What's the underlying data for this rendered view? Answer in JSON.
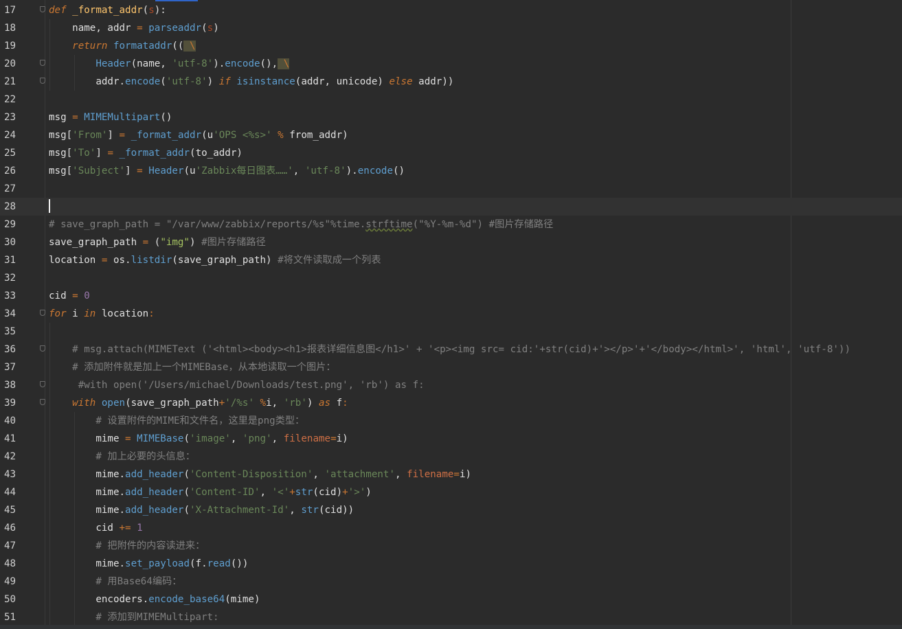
{
  "editor": {
    "language": "python",
    "current_line": 28,
    "colors": {
      "background": "#2b2b2b",
      "current_line": "#323232",
      "keyword": "#cc7832",
      "function": "#ffc66d",
      "string": "#6a8759",
      "number": "#9876aa",
      "comment": "#808080",
      "call": "#5f9fd0"
    },
    "lines": [
      {
        "n": "17",
        "tokens": [
          [
            "kw",
            "def"
          ],
          [
            "plain",
            " "
          ],
          [
            "fn",
            "_format_addr"
          ],
          [
            "plain",
            "("
          ],
          [
            "self",
            "s"
          ],
          [
            "plain",
            "):"
          ]
        ]
      },
      {
        "n": "18",
        "tokens": [
          [
            "plain",
            "    name, addr "
          ],
          [
            "op",
            "="
          ],
          [
            "plain",
            " "
          ],
          [
            "call",
            "parseaddr"
          ],
          [
            "plain",
            "("
          ],
          [
            "self",
            "s"
          ],
          [
            "plain",
            ")"
          ]
        ]
      },
      {
        "n": "19",
        "tokens": [
          [
            "plain",
            "    "
          ],
          [
            "kw",
            "return"
          ],
          [
            "plain",
            " "
          ],
          [
            "call",
            "formataddr"
          ],
          [
            "plain",
            "(("
          ],
          [
            "esc",
            " \\"
          ]
        ]
      },
      {
        "n": "20",
        "tokens": [
          [
            "plain",
            "        "
          ],
          [
            "call",
            "Header"
          ],
          [
            "plain",
            "(name, "
          ],
          [
            "str",
            "'utf-8'"
          ],
          [
            "plain",
            ")."
          ],
          [
            "call",
            "encode"
          ],
          [
            "plain",
            "(),"
          ],
          [
            "esc",
            " \\"
          ]
        ]
      },
      {
        "n": "21",
        "tokens": [
          [
            "plain",
            "        addr."
          ],
          [
            "call",
            "encode"
          ],
          [
            "plain",
            "("
          ],
          [
            "str",
            "'utf-8'"
          ],
          [
            "plain",
            ") "
          ],
          [
            "kw",
            "if"
          ],
          [
            "plain",
            " "
          ],
          [
            "call",
            "isinstance"
          ],
          [
            "plain",
            "(addr, unicode) "
          ],
          [
            "kw",
            "else"
          ],
          [
            "plain",
            " addr))"
          ]
        ]
      },
      {
        "n": "22",
        "tokens": []
      },
      {
        "n": "23",
        "tokens": [
          [
            "plain",
            "msg "
          ],
          [
            "op",
            "="
          ],
          [
            "plain",
            " "
          ],
          [
            "call",
            "MIMEMultipart"
          ],
          [
            "plain",
            "()"
          ]
        ]
      },
      {
        "n": "24",
        "tokens": [
          [
            "plain",
            "msg["
          ],
          [
            "str",
            "'From'"
          ],
          [
            "plain",
            "] "
          ],
          [
            "op",
            "="
          ],
          [
            "plain",
            " "
          ],
          [
            "call",
            "_format_addr"
          ],
          [
            "plain",
            "(u"
          ],
          [
            "str",
            "'OPS <%s>'"
          ],
          [
            "plain",
            " "
          ],
          [
            "op",
            "%"
          ],
          [
            "plain",
            " from_addr)"
          ]
        ]
      },
      {
        "n": "25",
        "tokens": [
          [
            "plain",
            "msg["
          ],
          [
            "str",
            "'To'"
          ],
          [
            "plain",
            "] "
          ],
          [
            "op",
            "="
          ],
          [
            "plain",
            " "
          ],
          [
            "call",
            "_format_addr"
          ],
          [
            "plain",
            "(to_addr)"
          ]
        ]
      },
      {
        "n": "26",
        "tokens": [
          [
            "plain",
            "msg["
          ],
          [
            "str",
            "'Subject'"
          ],
          [
            "plain",
            "] "
          ],
          [
            "op",
            "="
          ],
          [
            "plain",
            " "
          ],
          [
            "call",
            "Header"
          ],
          [
            "plain",
            "(u"
          ],
          [
            "str",
            "'Zabbix每日图表……'"
          ],
          [
            "plain",
            ", "
          ],
          [
            "str",
            "'utf-8'"
          ],
          [
            "plain",
            ")."
          ],
          [
            "call",
            "encode"
          ],
          [
            "plain",
            "()"
          ]
        ]
      },
      {
        "n": "27",
        "tokens": []
      },
      {
        "n": "28",
        "tokens": [
          [
            "caret",
            ""
          ]
        ]
      },
      {
        "n": "29",
        "tokens": [
          [
            "cm",
            "# save_graph_path = \"/var/www/zabbix/reports/%s\"%time."
          ],
          [
            "cmw",
            "strftime"
          ],
          [
            "cm",
            "(\"%Y-%m-%d\") #图片存储路径"
          ]
        ]
      },
      {
        "n": "30",
        "tokens": [
          [
            "plain",
            "save_graph_path "
          ],
          [
            "op",
            "="
          ],
          [
            "plain",
            " ("
          ],
          [
            "str2",
            "\"img\""
          ],
          [
            "plain",
            ") "
          ],
          [
            "cm",
            "#图片存储路径"
          ]
        ]
      },
      {
        "n": "31",
        "tokens": [
          [
            "plain",
            "location "
          ],
          [
            "op",
            "="
          ],
          [
            "plain",
            " os."
          ],
          [
            "call",
            "listdir"
          ],
          [
            "plain",
            "(save_graph_path) "
          ],
          [
            "cm",
            "#将文件读取成一个列表"
          ]
        ]
      },
      {
        "n": "32",
        "tokens": []
      },
      {
        "n": "33",
        "tokens": [
          [
            "plain",
            "cid "
          ],
          [
            "op",
            "="
          ],
          [
            "plain",
            " "
          ],
          [
            "num",
            "0"
          ]
        ]
      },
      {
        "n": "34",
        "tokens": [
          [
            "kw",
            "for"
          ],
          [
            "plain",
            " i "
          ],
          [
            "kw",
            "in"
          ],
          [
            "plain",
            " location"
          ],
          [
            "op",
            ":"
          ]
        ]
      },
      {
        "n": "35",
        "tokens": []
      },
      {
        "n": "36",
        "tokens": [
          [
            "plain",
            "    "
          ],
          [
            "cm",
            "# msg.attach(MIMEText ('<html><body><h1>报表详细信息图</h1>' + '<p><img src= cid:'+str(cid)+'></p>'+'</body></html>', 'html', 'utf-8'))"
          ]
        ]
      },
      {
        "n": "37",
        "tokens": [
          [
            "plain",
            "    "
          ],
          [
            "cm",
            "# 添加附件就是加上一个MIMEBase，从本地读取一个图片："
          ]
        ]
      },
      {
        "n": "38",
        "tokens": [
          [
            "plain",
            "     "
          ],
          [
            "cm",
            "#with open('/Users/michael/Downloads/test.png', 'rb') as f:"
          ]
        ]
      },
      {
        "n": "39",
        "tokens": [
          [
            "plain",
            "    "
          ],
          [
            "kw",
            "with"
          ],
          [
            "plain",
            " "
          ],
          [
            "call",
            "open"
          ],
          [
            "plain",
            "(save_graph_path"
          ],
          [
            "op",
            "+"
          ],
          [
            "str",
            "'/%s'"
          ],
          [
            "plain",
            " "
          ],
          [
            "op",
            "%"
          ],
          [
            "plain",
            "i, "
          ],
          [
            "str",
            "'rb'"
          ],
          [
            "plain",
            ") "
          ],
          [
            "kw",
            "as"
          ],
          [
            "plain",
            " f"
          ],
          [
            "op",
            ":"
          ]
        ]
      },
      {
        "n": "40",
        "tokens": [
          [
            "plain",
            "        "
          ],
          [
            "cm",
            "# 设置附件的MIME和文件名，这里是png类型："
          ]
        ]
      },
      {
        "n": "41",
        "tokens": [
          [
            "plain",
            "        mime "
          ],
          [
            "op",
            "="
          ],
          [
            "plain",
            " "
          ],
          [
            "call",
            "MIMEBase"
          ],
          [
            "plain",
            "("
          ],
          [
            "str",
            "'image'"
          ],
          [
            "plain",
            ", "
          ],
          [
            "str",
            "'png'"
          ],
          [
            "plain",
            ", "
          ],
          [
            "param",
            "filename"
          ],
          [
            "op",
            "="
          ],
          [
            "plain",
            "i)"
          ]
        ]
      },
      {
        "n": "42",
        "tokens": [
          [
            "plain",
            "        "
          ],
          [
            "cm",
            "# 加上必要的头信息："
          ]
        ]
      },
      {
        "n": "43",
        "tokens": [
          [
            "plain",
            "        mime."
          ],
          [
            "call",
            "add_header"
          ],
          [
            "plain",
            "("
          ],
          [
            "str",
            "'Content-Disposition'"
          ],
          [
            "plain",
            ", "
          ],
          [
            "str",
            "'attachment'"
          ],
          [
            "plain",
            ", "
          ],
          [
            "param",
            "filename"
          ],
          [
            "op",
            "="
          ],
          [
            "plain",
            "i)"
          ]
        ]
      },
      {
        "n": "44",
        "tokens": [
          [
            "plain",
            "        mime."
          ],
          [
            "call",
            "add_header"
          ],
          [
            "plain",
            "("
          ],
          [
            "str",
            "'Content-ID'"
          ],
          [
            "plain",
            ", "
          ],
          [
            "str",
            "'<'"
          ],
          [
            "op",
            "+"
          ],
          [
            "call",
            "str"
          ],
          [
            "plain",
            "(cid)"
          ],
          [
            "op",
            "+"
          ],
          [
            "str",
            "'>'"
          ],
          [
            "plain",
            ")"
          ]
        ]
      },
      {
        "n": "45",
        "tokens": [
          [
            "plain",
            "        mime."
          ],
          [
            "call",
            "add_header"
          ],
          [
            "plain",
            "("
          ],
          [
            "str",
            "'X-Attachment-Id'"
          ],
          [
            "plain",
            ", "
          ],
          [
            "call",
            "str"
          ],
          [
            "plain",
            "(cid))"
          ]
        ]
      },
      {
        "n": "46",
        "tokens": [
          [
            "plain",
            "        cid "
          ],
          [
            "op",
            "+="
          ],
          [
            "plain",
            " "
          ],
          [
            "num",
            "1"
          ]
        ]
      },
      {
        "n": "47",
        "tokens": [
          [
            "plain",
            "        "
          ],
          [
            "cm",
            "# 把附件的内容读进来："
          ]
        ]
      },
      {
        "n": "48",
        "tokens": [
          [
            "plain",
            "        mime."
          ],
          [
            "call",
            "set_payload"
          ],
          [
            "plain",
            "(f."
          ],
          [
            "call",
            "read"
          ],
          [
            "plain",
            "())"
          ]
        ]
      },
      {
        "n": "49",
        "tokens": [
          [
            "plain",
            "        "
          ],
          [
            "cm",
            "# 用Base64编码："
          ]
        ]
      },
      {
        "n": "50",
        "tokens": [
          [
            "plain",
            "        encoders."
          ],
          [
            "call",
            "encode_base64"
          ],
          [
            "plain",
            "(mime)"
          ]
        ]
      },
      {
        "n": "51",
        "tokens": [
          [
            "plain",
            "        "
          ],
          [
            "cm",
            "# 添加到MIMEMultipart:"
          ]
        ]
      }
    ]
  }
}
